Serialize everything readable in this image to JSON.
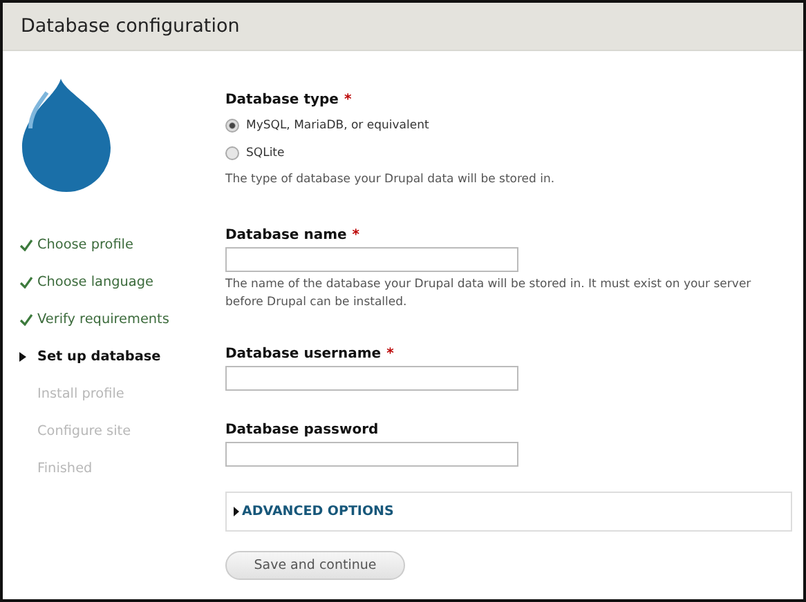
{
  "window": {
    "title": "Database configuration"
  },
  "steps": [
    {
      "label": "Choose profile",
      "completed": true,
      "selected": false
    },
    {
      "label": "Choose language",
      "completed": true,
      "selected": false
    },
    {
      "label": "Verify requirements",
      "completed": true,
      "selected": false
    },
    {
      "label": "Set up database",
      "completed": false,
      "selected": true
    },
    {
      "label": "Install profile",
      "completed": false,
      "selected": false
    },
    {
      "label": "Configure site",
      "completed": false,
      "selected": false
    },
    {
      "label": "Finished",
      "completed": false,
      "selected": false
    }
  ],
  "database_type": {
    "label": "Database type",
    "required_mark": "*",
    "options": [
      {
        "label": "MySQL, MariaDB, or equivalent",
        "selected": true
      },
      {
        "label": "SQLite",
        "selected": false
      }
    ],
    "description": "The type of database your Drupal data will be stored in."
  },
  "fields": [
    {
      "label": "Database name",
      "required_mark": "*",
      "description": "The name of the database your Drupal data will be stored in. It must exist on your server before Drupal can be installed."
    },
    {
      "label": "Database username",
      "required_mark": "*"
    },
    {
      "label": "Database password"
    }
  ],
  "advanced": {
    "label": "ADVANCED OPTIONS",
    "expanded": false
  },
  "submit": "Save and continue"
}
